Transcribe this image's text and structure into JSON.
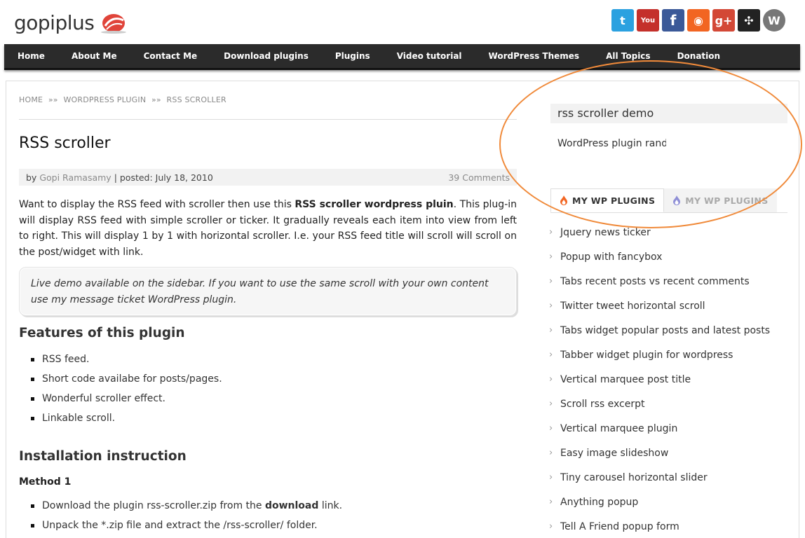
{
  "brand": {
    "logo_text": "gopiplus"
  },
  "social": [
    {
      "icon": "twitter-icon",
      "color": "#2ba1e0",
      "glyph": "t"
    },
    {
      "icon": "youtube-icon",
      "color": "#c4302b",
      "glyph": "You"
    },
    {
      "icon": "facebook-icon",
      "color": "#3b5998",
      "glyph": "f"
    },
    {
      "icon": "rss-icon",
      "color": "#f26522",
      "glyph": "◉"
    },
    {
      "icon": "google-plus-icon",
      "color": "#d34836",
      "glyph": "g+"
    },
    {
      "icon": "joomla-icon",
      "color": "#222222",
      "glyph": "✣"
    },
    {
      "icon": "wordpress-icon",
      "color": "#777777",
      "glyph": "W"
    }
  ],
  "nav": {
    "home": "Home",
    "about": "About Me",
    "contact": "Contact Me",
    "download": "Download plugins",
    "plugins": "Plugins",
    "video": "Video tutorial",
    "themes": "WordPress Themes",
    "topics": "All Topics",
    "donation": "Donation"
  },
  "breadcrumb": {
    "home": "HOME",
    "sep1": "»»",
    "section": "WORDPRESS PLUGIN",
    "sep2": "»»",
    "current": "RSS SCROLLER"
  },
  "post": {
    "title": "RSS scroller",
    "by": "by",
    "author": "Gopi Ramasamy",
    "posted": "| posted: July 18, 2010",
    "comments": "39 Comments",
    "intro_1": "Want to display the RSS feed with scroller then use this ",
    "intro_bold": "RSS scroller wordpress pluin",
    "intro_2": ". This plug-in will display RSS feed with simple scroller or ticker. It gradually reveals each item into view from left to right. This will display 1 by 1 with horizontal scroller. I.e. your RSS feed title will scroll will scroll on the post/widget with link.",
    "quote": "Live demo available on the sidebar. If you want to use the same scroll with your own content use my message ticket WordPress plugin.",
    "features_heading": "Features of this plugin",
    "features": [
      "RSS feed.",
      "Short code availabe for posts/pages.",
      "Wonderful scroller effect.",
      "Linkable scroll."
    ],
    "install_heading": "Installation instruction",
    "method_heading": "Method 1",
    "method1_a_pre": "Download the plugin rss-scroller.zip from the ",
    "method1_a_bold": "download",
    "method1_a_post": " link.",
    "method1_b": "Unpack the *.zip file and extract the /rss-scroller/ folder."
  },
  "sidebar": {
    "widget_title": "rss scroller demo",
    "ticker_text": "WordPress plugin random",
    "tab_active": "MY WP PLUGINS",
    "tab_inactive": "MY WP PLUGINS",
    "plugins": [
      "Jquery news ticker",
      "Popup with fancybox",
      "Tabs recent posts vs recent comments",
      "Twitter tweet horizontal scroll",
      "Tabs widget popular posts and latest posts",
      "Tabber widget plugin for wordpress",
      "Vertical marquee post title",
      "Scroll rss excerpt",
      "Vertical marquee plugin",
      "Easy image slideshow",
      "Tiny carousel horizontal slider",
      "Anything popup",
      "Tell A Friend popup form"
    ]
  },
  "colors": {
    "nav_bg": "#2b2b2b",
    "annotation": "#f08a3a",
    "logo_accent": "#e0443a"
  }
}
